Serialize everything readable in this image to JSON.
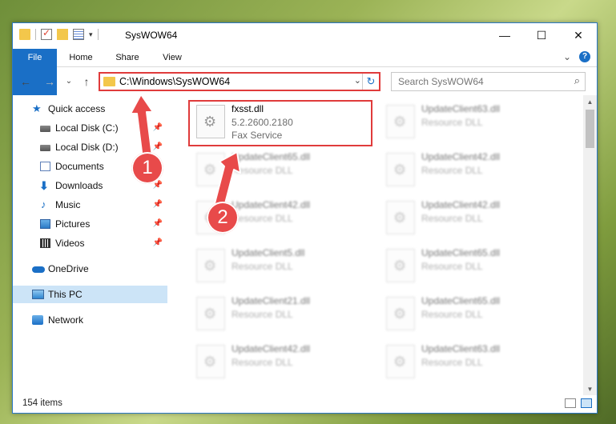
{
  "window": {
    "title": "SysWOW64",
    "controls": {
      "minimize": "—",
      "maximize": "☐",
      "close": "✕"
    }
  },
  "ribbon": {
    "tabs": [
      "File",
      "Home",
      "Share",
      "View"
    ],
    "expand_icon": "⌄",
    "help_icon": "?"
  },
  "nav": {
    "back": "←",
    "forward": "→",
    "recent": "⌄",
    "up": "↑",
    "address": "C:\\Windows\\SysWOW64",
    "dropdown": "⌄",
    "refresh": "↻",
    "search_placeholder": "Search SysWOW64",
    "search_icon": "⌕"
  },
  "sidebar": {
    "items": [
      {
        "label": "Quick access",
        "icon": "star-icon",
        "pinned": false
      },
      {
        "label": "Local Disk (C:)",
        "icon": "disk-icon",
        "pinned": true
      },
      {
        "label": "Local Disk (D:)",
        "icon": "disk-icon",
        "pinned": true
      },
      {
        "label": "Documents",
        "icon": "documents-icon",
        "pinned": true
      },
      {
        "label": "Downloads",
        "icon": "downloads-icon",
        "pinned": true
      },
      {
        "label": "Music",
        "icon": "music-icon",
        "pinned": true
      },
      {
        "label": "Pictures",
        "icon": "pictures-icon",
        "pinned": true
      },
      {
        "label": "Videos",
        "icon": "videos-icon",
        "pinned": true
      },
      {
        "label": "OneDrive",
        "icon": "onedrive-icon",
        "pinned": false
      },
      {
        "label": "This PC",
        "icon": "this-pc-icon",
        "pinned": false
      },
      {
        "label": "Network",
        "icon": "network-icon",
        "pinned": false
      }
    ],
    "pin_glyph": "📌"
  },
  "files": [
    {
      "name": "fxsst.dll",
      "line2": "5.2.2600.2180",
      "line3": "Fax Service",
      "highlighted": true
    },
    {
      "name": "UpdateClient63.dll",
      "line2": "Resource DLL",
      "blurred": true
    },
    {
      "name": "UpdateClient65.dll",
      "line2": "Resource DLL",
      "blurred": true
    },
    {
      "name": "UpdateClient42.dll",
      "line2": "Resource DLL",
      "blurred": true
    },
    {
      "name": "UpdateClient42.dll",
      "line2": "Resource DLL",
      "blurred": true
    },
    {
      "name": "UpdateClient42.dll",
      "line2": "Resource DLL",
      "blurred": true
    },
    {
      "name": "UpdateClient5.dll",
      "line2": "Resource DLL",
      "blurred": true
    },
    {
      "name": "UpdateClient65.dll",
      "line2": "Resource DLL",
      "blurred": true
    },
    {
      "name": "UpdateClient21.dll",
      "line2": "Resource DLL",
      "blurred": true
    },
    {
      "name": "UpdateClient65.dll",
      "line2": "Resource DLL",
      "blurred": true
    },
    {
      "name": "UpdateClient42.dll",
      "line2": "Resource DLL",
      "blurred": true
    },
    {
      "name": "UpdateClient63.dll",
      "line2": "Resource DLL",
      "blurred": true
    }
  ],
  "status": {
    "item_count": "154 items"
  },
  "annotations": {
    "step1": "1",
    "step2": "2",
    "color": "#e84a4a"
  }
}
